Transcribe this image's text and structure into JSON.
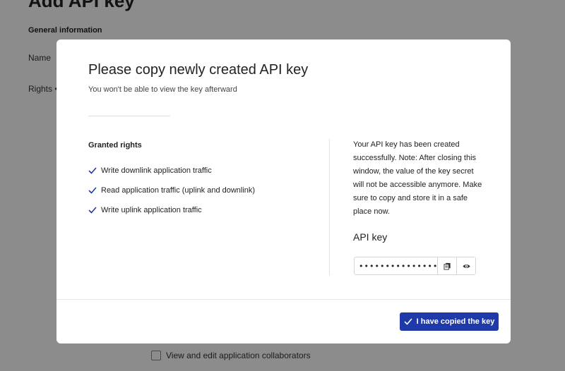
{
  "background": {
    "page_title": "Add API key",
    "section_heading": "General information",
    "name_label": "Name",
    "rights_label": "Rights",
    "rights_required_marker": "•",
    "collaborators_option": "View and edit application collaborators"
  },
  "modal": {
    "title": "Please copy newly created API key",
    "subtitle": "You won't be able to view the key afterward",
    "granted_rights_heading": "Granted rights",
    "granted_rights": [
      "Write downlink application traffic",
      "Read application traffic (uplink and downlink)",
      "Write uplink application traffic"
    ],
    "info_text": "Your API key has been created successfully. Note: After closing this window, the value of the key secret will not be accessible anymore. Make sure to copy and store it in a safe place now.",
    "api_key_label": "API key",
    "api_key_masked": "••••••••••••••••",
    "copy_icon": "copy-icon",
    "reveal_icon": "eye-icon",
    "confirm_button": "I have copied the key"
  },
  "colors": {
    "primary": "#1f3aa8",
    "check": "#1f3aa8",
    "overlay": "rgba(0,0,0,0.45)"
  }
}
